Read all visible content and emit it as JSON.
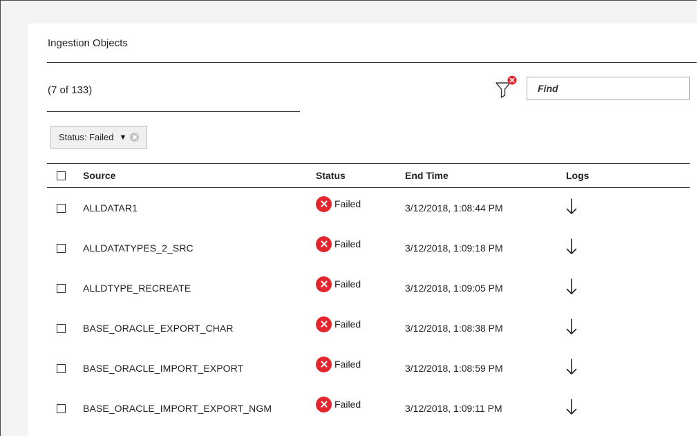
{
  "panel": {
    "title": "Ingestion Objects",
    "count_text": "(7 of 133)"
  },
  "toolbar": {
    "filter_icon": "filter-clear-icon",
    "find_placeholder": "Find"
  },
  "active_filter": {
    "label": "Status: Failed"
  },
  "table": {
    "headers": {
      "source": "Source",
      "status": "Status",
      "end_time": "End Time",
      "logs": "Logs"
    },
    "rows": [
      {
        "source": "ALLDATAR1",
        "status": "Failed",
        "end_time": "3/12/2018, 1:08:44 PM"
      },
      {
        "source": "ALLDATATYPES_2_SRC",
        "status": "Failed",
        "end_time": "3/12/2018, 1:09:18 PM"
      },
      {
        "source": "ALLDTYPE_RECREATE",
        "status": "Failed",
        "end_time": "3/12/2018, 1:09:05 PM"
      },
      {
        "source": "BASE_ORACLE_EXPORT_CHAR",
        "status": "Failed",
        "end_time": "3/12/2018, 1:08:38 PM"
      },
      {
        "source": "BASE_ORACLE_IMPORT_EXPORT",
        "status": "Failed",
        "end_time": "3/12/2018, 1:08:59 PM"
      },
      {
        "source": "BASE_ORACLE_IMPORT_EXPORT_NGM",
        "status": "Failed",
        "end_time": "3/12/2018, 1:09:11 PM"
      }
    ]
  },
  "colors": {
    "failed_badge": "#e1262d",
    "rule": "#333333",
    "chip_bg": "#f0f0f0"
  }
}
